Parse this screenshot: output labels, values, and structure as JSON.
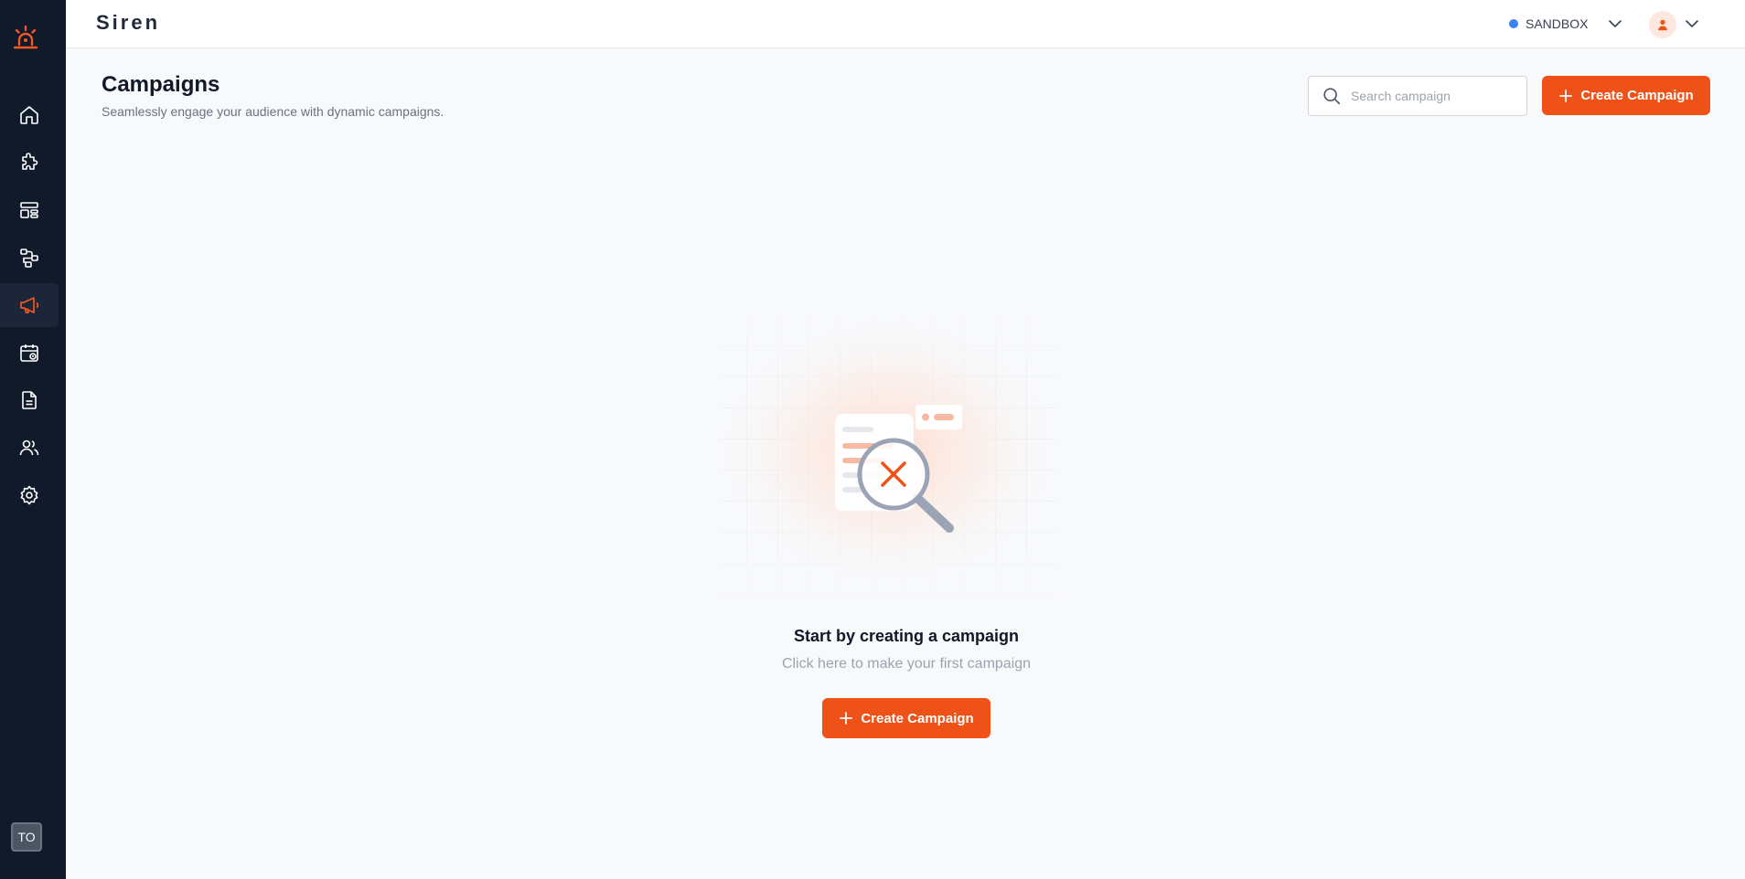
{
  "app": {
    "brand": "Siren"
  },
  "header": {
    "environment": "SANDBOX",
    "environment_color": "#3b82f6"
  },
  "sidebar": {
    "items": [
      {
        "name": "home-icon",
        "active": false
      },
      {
        "name": "puzzle-icon",
        "active": false
      },
      {
        "name": "layout-icon",
        "active": false
      },
      {
        "name": "workflow-icon",
        "active": false
      },
      {
        "name": "megaphone-icon",
        "active": true
      },
      {
        "name": "calendar-icon",
        "active": false
      },
      {
        "name": "document-icon",
        "active": false
      },
      {
        "name": "users-icon",
        "active": false
      },
      {
        "name": "gear-icon",
        "active": false
      }
    ],
    "user_initials": "TO"
  },
  "page": {
    "title": "Campaigns",
    "subtitle": "Seamlessly engage your audience with dynamic campaigns.",
    "search_placeholder": "Search campaign",
    "create_label": "Create Campaign"
  },
  "empty_state": {
    "title": "Start by creating a campaign",
    "subtitle": "Click here to make your first campaign",
    "button_label": "Create Campaign"
  },
  "colors": {
    "accent": "#ef5219",
    "sidebar_bg": "#111a2b",
    "page_bg": "#f8f9fb"
  }
}
